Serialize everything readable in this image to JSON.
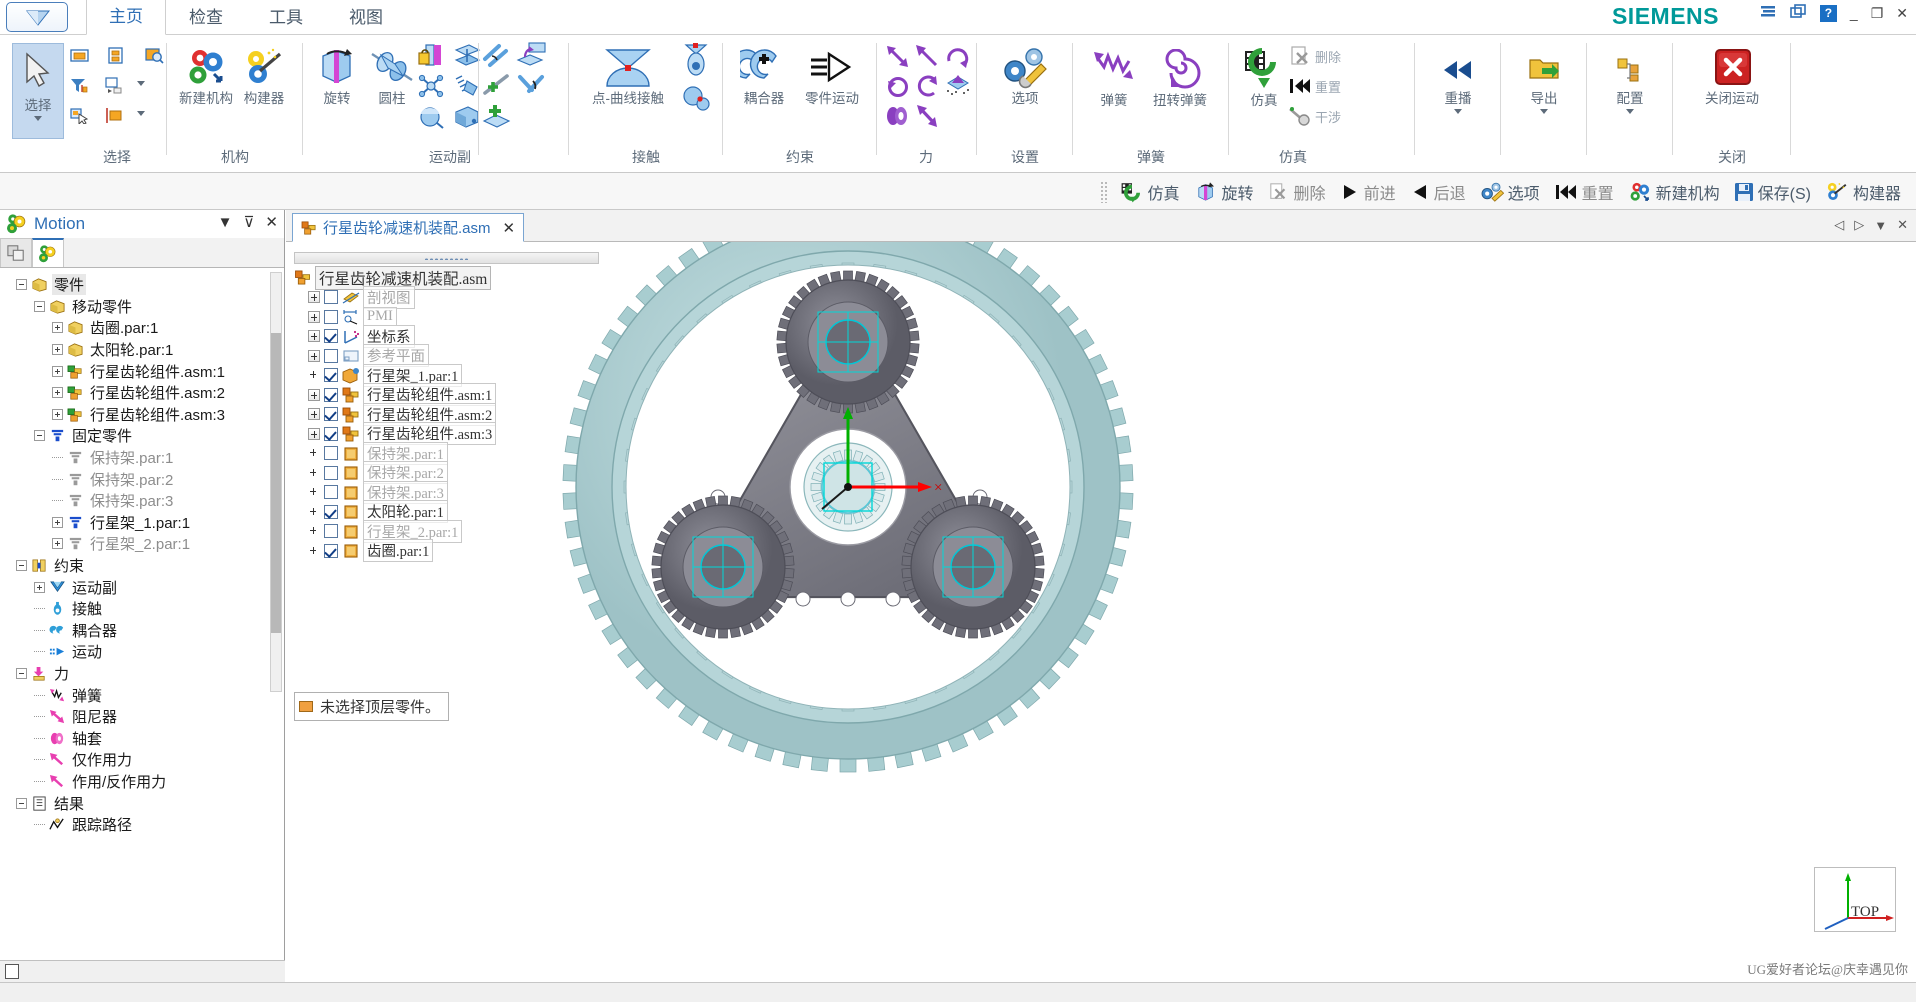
{
  "window": {
    "brand": "SIEMENS",
    "app_button": "application-menu",
    "title_buttons": [
      "layout-icon",
      "windows-icon",
      "help-icon",
      "minimize",
      "restore",
      "close"
    ],
    "help_label": "?",
    "minimize_label": "_",
    "restore_label": "❐",
    "close_label": "✕"
  },
  "tabs": [
    {
      "label": "主页",
      "active": true
    },
    {
      "label": "检查",
      "active": false
    },
    {
      "label": "工具",
      "active": false
    },
    {
      "label": "视图",
      "active": false
    }
  ],
  "ribbon": {
    "groups": [
      {
        "name": "选择",
        "big": [
          {
            "label": "选择",
            "icon": "arrow-cursor-icon",
            "selected": true,
            "has_caret": true
          }
        ],
        "small": [
          {
            "label": "",
            "icon": "select-all-icon"
          },
          {
            "label": "",
            "icon": "select-part-icon"
          },
          {
            "label": "",
            "icon": "zoom-select-icon"
          },
          {
            "label": "",
            "icon": "filter-icon"
          },
          {
            "label": "",
            "icon": "select-through-icon",
            "caret": true
          },
          {
            "label": "",
            "icon": "select-region-icon"
          },
          {
            "label": "",
            "icon": "select-edge-icon",
            "caret": true
          }
        ]
      },
      {
        "name": "机构",
        "big": [
          {
            "label": "新建机构",
            "icon": "new-mechanism-icon"
          },
          {
            "label": "构建器",
            "icon": "mechanism-builder-icon"
          }
        ]
      },
      {
        "name": "运动副",
        "big": [
          {
            "label": "旋转",
            "icon": "revolute-joint-icon"
          },
          {
            "label": "圆柱",
            "icon": "cylindrical-joint-icon"
          }
        ],
        "small": [
          {
            "icon": "fixed-joint-icon"
          },
          {
            "icon": "planar-joint-icon"
          },
          {
            "icon": "universal-joint-icon"
          },
          {
            "icon": "screw-joint-icon"
          },
          {
            "icon": "spherical-joint-icon"
          },
          {
            "icon": "slider-joint-icon"
          },
          {
            "icon": "parallel-joint-icon"
          },
          {
            "icon": "point-on-plane-icon"
          },
          {
            "icon": "inline-joint-icon"
          },
          {
            "icon": "perpendicular-joint-icon"
          },
          {
            "icon": "point-in-plane-icon"
          }
        ]
      },
      {
        "name": "接触",
        "big": [
          {
            "label": "点-曲线接触",
            "icon": "point-curve-contact-icon"
          }
        ],
        "small": [
          {
            "icon": "point-point-contact-icon"
          },
          {
            "icon": "sphere-contact-icon"
          }
        ]
      },
      {
        "name": "约束",
        "big": [
          {
            "label": "耦合器",
            "icon": "coupler-icon"
          },
          {
            "label": "零件运动",
            "icon": "part-motion-icon"
          }
        ]
      },
      {
        "name": "力",
        "small": [
          {
            "icon": "force-bidir-icon"
          },
          {
            "icon": "force-single-icon"
          },
          {
            "icon": "torque-cw-icon"
          },
          {
            "icon": "torque-ccw-icon"
          },
          {
            "icon": "torque-arc-icon"
          },
          {
            "icon": "force-vector-icon"
          },
          {
            "icon": "bushing-icon"
          },
          {
            "icon": "force-arrow-icon"
          }
        ]
      },
      {
        "name": "设置",
        "big": [
          {
            "label": "选项",
            "icon": "options-wrench-gear-icon"
          }
        ]
      },
      {
        "name": "弹簧",
        "big": [
          {
            "label": "弹簧",
            "icon": "spring-icon"
          },
          {
            "label": "扭转弹簧",
            "icon": "torsion-spring-icon"
          }
        ]
      },
      {
        "name": "仿真",
        "big": [
          {
            "label": "仿真",
            "icon": "simulate-film-icon"
          }
        ],
        "small": [
          {
            "label": "删除",
            "icon": "delete-icon",
            "enabled": false
          },
          {
            "label": "重置",
            "icon": "reset-icon",
            "enabled": false
          },
          {
            "label": "干涉",
            "icon": "interference-icon",
            "enabled": false
          }
        ]
      },
      {
        "name": "",
        "big": [
          {
            "label": "重播",
            "icon": "replay-icon",
            "has_caret": true
          }
        ]
      },
      {
        "name": "",
        "big": [
          {
            "label": "导出",
            "icon": "export-folder-icon",
            "has_caret": true
          }
        ]
      },
      {
        "name": "",
        "big": [
          {
            "label": "配置",
            "icon": "configure-icon",
            "has_caret": true
          }
        ]
      },
      {
        "name": "关闭",
        "big": [
          {
            "label": "关闭运动",
            "icon": "close-motion-red-x-icon"
          }
        ]
      }
    ]
  },
  "quickbar": {
    "items": [
      {
        "label": "仿真",
        "icon": "simulate-film-icon",
        "enabled": true
      },
      {
        "label": "旋转",
        "icon": "revolute-joint-icon",
        "enabled": true
      },
      {
        "label": "删除",
        "icon": "delete-icon",
        "enabled": false
      },
      {
        "label": "前进",
        "icon": "play-forward-icon",
        "enabled": false
      },
      {
        "label": "后退",
        "icon": "play-back-icon",
        "enabled": false
      },
      {
        "label": "选项",
        "icon": "options-wrench-gear-icon",
        "enabled": true
      },
      {
        "label": "重置",
        "icon": "reset-icon",
        "enabled": false
      },
      {
        "label": "新建机构",
        "icon": "new-mechanism-icon",
        "enabled": true
      },
      {
        "label": "保存(S)",
        "icon": "save-disk-icon",
        "enabled": true
      },
      {
        "label": "构建器",
        "icon": "mechanism-builder-icon",
        "enabled": true
      }
    ]
  },
  "left_panel": {
    "title": "Motion",
    "title_icon": "motion-gears-icon",
    "header_buttons": [
      "collapse-icon",
      "pin-icon",
      "close-icon"
    ],
    "collapse_label": "▼",
    "pin_label": "⊽",
    "close_label": "✕",
    "tabs": [
      {
        "icon": "pathfinder-icon",
        "active": false
      },
      {
        "icon": "motion-gears-icon",
        "active": true
      }
    ],
    "tree": [
      {
        "label": "零件",
        "indent": 0,
        "expander": "minus",
        "icon": "part-cube-icon",
        "selected": true
      },
      {
        "label": "移动零件",
        "indent": 1,
        "expander": "minus",
        "icon": "part-cube-icon"
      },
      {
        "label": "齿圈.par:1",
        "indent": 2,
        "expander": "plus",
        "icon": "part-cube-icon"
      },
      {
        "label": "太阳轮.par:1",
        "indent": 2,
        "expander": "plus",
        "icon": "part-cube-icon"
      },
      {
        "label": "行星齿轮组件.asm:1",
        "indent": 2,
        "expander": "plus",
        "icon": "assembly-icon"
      },
      {
        "label": "行星齿轮组件.asm:2",
        "indent": 2,
        "expander": "plus",
        "icon": "assembly-icon"
      },
      {
        "label": "行星齿轮组件.asm:3",
        "indent": 2,
        "expander": "plus",
        "icon": "assembly-icon"
      },
      {
        "label": "固定零件",
        "indent": 1,
        "expander": "minus",
        "icon": "ground-icon"
      },
      {
        "label": "保持架.par:1",
        "indent": 2,
        "expander": "leaf",
        "icon": "ground-gray-icon"
      },
      {
        "label": "保持架.par:2",
        "indent": 2,
        "expander": "leaf",
        "icon": "ground-gray-icon"
      },
      {
        "label": "保持架.par:3",
        "indent": 2,
        "expander": "leaf",
        "icon": "ground-gray-icon"
      },
      {
        "label": "行星架_1.par:1",
        "indent": 2,
        "expander": "plus",
        "icon": "ground-icon"
      },
      {
        "label": "行星架_2.par:1",
        "indent": 2,
        "expander": "plus",
        "icon": "ground-gray-icon"
      },
      {
        "label": "约束",
        "indent": 0,
        "expander": "minus",
        "icon": "constraint-icon"
      },
      {
        "label": "运动副",
        "indent": 1,
        "expander": "plus",
        "icon": "joint-icon"
      },
      {
        "label": "接触",
        "indent": 1,
        "expander": "leaf",
        "icon": "contact-icon"
      },
      {
        "label": "耦合器",
        "indent": 1,
        "expander": "leaf",
        "icon": "coupler-small-icon"
      },
      {
        "label": "运动",
        "indent": 1,
        "expander": "leaf",
        "icon": "motion-arrow-icon"
      },
      {
        "label": "力",
        "indent": 0,
        "expander": "minus",
        "icon": "force-yellow-icon"
      },
      {
        "label": "弹簧",
        "indent": 1,
        "expander": "leaf",
        "icon": "spring-pink-icon"
      },
      {
        "label": "阻尼器",
        "indent": 1,
        "expander": "leaf",
        "icon": "damper-pink-icon"
      },
      {
        "label": "轴套",
        "indent": 1,
        "expander": "leaf",
        "icon": "bushing-pink-icon"
      },
      {
        "label": "仅作用力",
        "indent": 1,
        "expander": "leaf",
        "icon": "force-only-icon"
      },
      {
        "label": "作用/反作用力",
        "indent": 1,
        "expander": "leaf",
        "icon": "action-reaction-icon"
      },
      {
        "label": "结果",
        "indent": 0,
        "expander": "minus",
        "icon": "results-icon"
      },
      {
        "label": "跟踪路径",
        "indent": 1,
        "expander": "leaf",
        "icon": "trace-path-icon"
      }
    ]
  },
  "document": {
    "tab_label": "行星齿轮减速机装配.asm",
    "tab_icon": "assembly-icon",
    "tab_close": "✕",
    "nav": [
      "◁",
      "▷",
      "▼",
      "✕"
    ]
  },
  "assembly_tree": {
    "root": {
      "label": "行星齿轮减速机装配.asm",
      "icon": "assembly-icon"
    },
    "items": [
      {
        "label": "剖视图",
        "expander": true,
        "checked": false,
        "icon": "section-view-icon",
        "dim": true
      },
      {
        "label": "PMI",
        "expander": true,
        "checked": false,
        "icon": "pmi-icon",
        "dim": true
      },
      {
        "label": "坐标系",
        "expander": true,
        "checked": true,
        "icon": "coordinate-system-icon",
        "dim": false
      },
      {
        "label": "参考平面",
        "expander": true,
        "checked": false,
        "icon": "reference-plane-icon",
        "dim": true
      },
      {
        "label": "行星架_1.par:1",
        "expander": false,
        "checked": true,
        "icon": "part-selected-icon",
        "dim": false
      },
      {
        "label": "行星齿轮组件.asm:1",
        "expander": true,
        "checked": true,
        "icon": "assembly-icon",
        "dim": false
      },
      {
        "label": "行星齿轮组件.asm:2",
        "expander": true,
        "checked": true,
        "icon": "assembly-icon",
        "dim": false
      },
      {
        "label": "行星齿轮组件.asm:3",
        "expander": true,
        "checked": true,
        "icon": "assembly-icon",
        "dim": false
      },
      {
        "label": "保持架.par:1",
        "expander": false,
        "checked": false,
        "icon": "part-orange-icon",
        "dim": true
      },
      {
        "label": "保持架.par:2",
        "expander": false,
        "checked": false,
        "icon": "part-orange-icon",
        "dim": true
      },
      {
        "label": "保持架.par:3",
        "expander": false,
        "checked": false,
        "icon": "part-orange-icon",
        "dim": true
      },
      {
        "label": "太阳轮.par:1",
        "expander": false,
        "checked": true,
        "icon": "part-orange-icon",
        "dim": false
      },
      {
        "label": "行星架_2.par:1",
        "expander": false,
        "checked": false,
        "icon": "part-orange-icon",
        "dim": true
      },
      {
        "label": "齿圈.par:1",
        "expander": false,
        "checked": true,
        "icon": "part-orange-icon",
        "dim": false
      }
    ]
  },
  "viewport": {
    "hint_text": "未选择顶层零件。",
    "hint_swatch_color": "#f0a040",
    "view_cube_label": "TOP",
    "watermark": "UG爱好者论坛@庆幸遇见你",
    "model_colors": {
      "ring_gear": "#9fc6c8",
      "carrier": "#7d7d84",
      "planet_gear": "#6f6f77",
      "sun_gear": "#c9d9dc",
      "axis_x": "#ff0000",
      "axis_y": "#00b000",
      "highlight": "#00d8d8"
    }
  }
}
